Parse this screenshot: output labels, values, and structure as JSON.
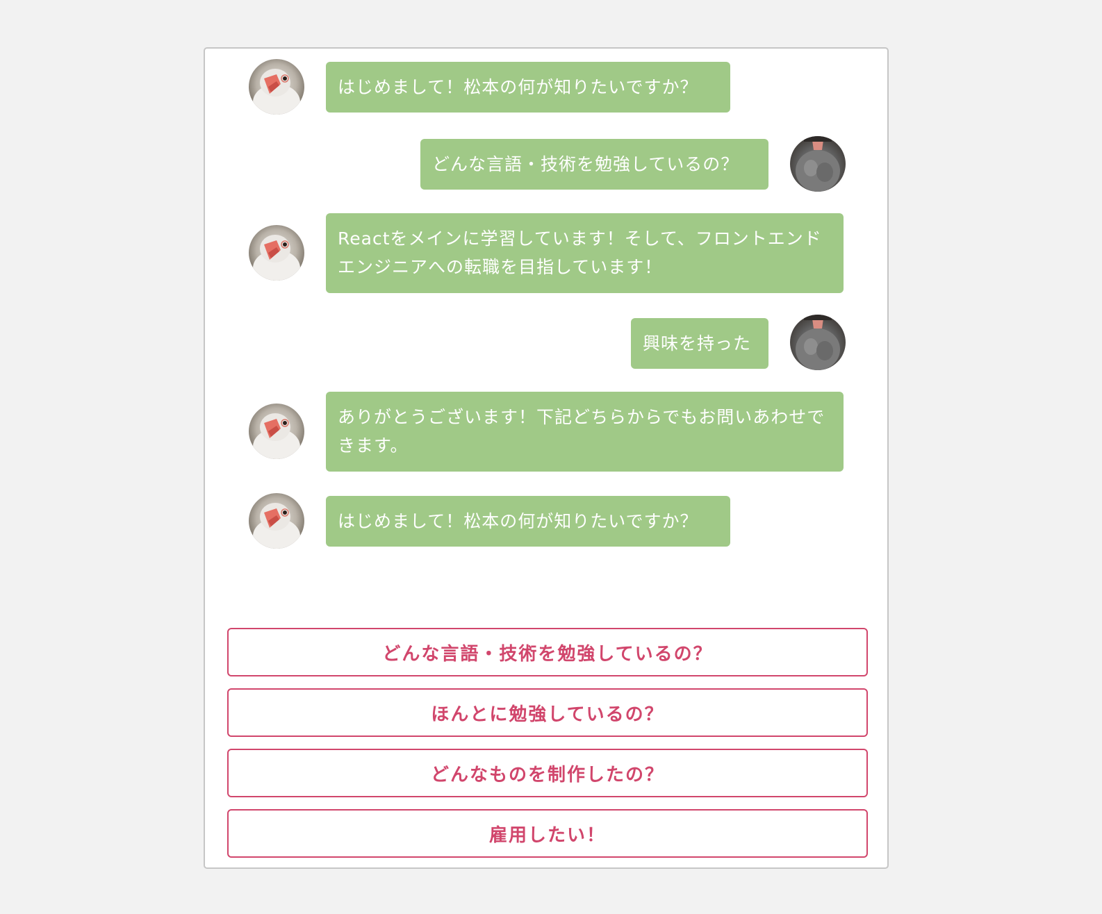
{
  "colors": {
    "page_background": "#f2f2f2",
    "bubble": "#a0c987",
    "bubble_text": "#ffffff",
    "accent": "#d1466c",
    "panel_border": "#c6c6c6"
  },
  "messages": [
    {
      "sender": "bot",
      "avatar_icon": "bird-avatar-icon",
      "text": "はじめまして！松本の何が知りたいですか？"
    },
    {
      "sender": "user",
      "avatar_icon": "user-bird-avatar-icon",
      "text": "どんな言語・技術を勉強しているの？"
    },
    {
      "sender": "bot",
      "avatar_icon": "bird-avatar-icon",
      "text": "Reactをメインに学習しています！そして、フロントエンドエンジニアへの転職を目指しています！"
    },
    {
      "sender": "user",
      "avatar_icon": "user-bird-avatar-icon",
      "text": "興味を持った"
    },
    {
      "sender": "bot",
      "avatar_icon": "bird-avatar-icon",
      "text": "ありがとうございます！下記どちらからでもお問いあわせできます。"
    },
    {
      "sender": "bot",
      "avatar_icon": "bird-avatar-icon",
      "text": "はじめまして！松本の何が知りたいですか？"
    }
  ],
  "choices": [
    {
      "label": "どんな言語・技術を勉強しているの？"
    },
    {
      "label": "ほんとに勉強しているの？"
    },
    {
      "label": "どんなものを制作したの？"
    },
    {
      "label": "雇用したい！"
    }
  ]
}
